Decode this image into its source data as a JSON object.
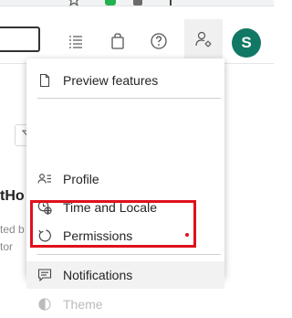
{
  "header": {
    "avatar_initial": "S",
    "icons": [
      "star-icon",
      "list-icon",
      "bag-icon",
      "help-icon",
      "user-settings-icon"
    ]
  },
  "menu": {
    "items": [
      {
        "label": "Preview features",
        "icon": "document-icon"
      },
      {
        "label": "Profile",
        "icon": "profile-icon"
      },
      {
        "label": "Time and Locale",
        "icon": "clock-globe-icon"
      },
      {
        "label": "Permissions",
        "icon": "permissions-icon"
      },
      {
        "label": "Notifications",
        "icon": "chat-icon"
      },
      {
        "label": "Theme",
        "icon": "theme-icon"
      }
    ]
  },
  "background": {
    "title_fragment": "tHo",
    "line1_fragment": "ted b",
    "line2_fragment": "tor"
  },
  "colors": {
    "avatar": "#117865",
    "highlight": "#e0101b",
    "hover": "#f2f2f2"
  }
}
